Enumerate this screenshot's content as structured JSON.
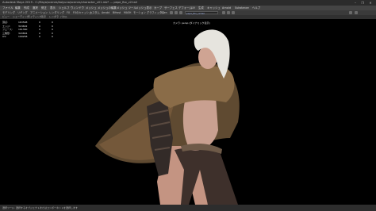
{
  "window": {
    "title": "Autodesk Maya 2019 - C:/Maya/scenes/kaiyuna/scenes/character_v01.mb* --- pepe_fbx_v2:tail",
    "controls": [
      "–",
      "❐",
      "✕"
    ]
  },
  "menubar": {
    "items": [
      "ファイル",
      "編集",
      "作成",
      "選択",
      "修正",
      "表示",
      "シェルフ",
      "ウィンドウ",
      "メッシュ",
      "メッシュの編集",
      "メッシュ ツール",
      "メッシュ表示",
      "カーブ",
      "サーフェス",
      "デフォーム",
      "UV",
      "生成",
      "キャッシュ",
      "Arnold",
      "Substance",
      "ヘルプ"
    ]
  },
  "shelf": {
    "items": [
      "モデリング",
      "リギング",
      "アニメーション",
      "レンダリング",
      "FX",
      "FXのキャッシュ",
      "カスタム",
      "Arnold",
      "Bifrost",
      "MASH",
      "モーション グラフィックス",
      "XGen"
    ],
    "field_value": "pepe_fbx_v2:tail"
  },
  "panel_menu": {
    "items": [
      "ビュー",
      "シェーディング",
      "ライティング",
      "表示",
      "レンダラ",
      "パネル"
    ]
  },
  "viewport": {
    "camera_label": "カメラ: persp (ダイナミック表示)",
    "stats": [
      {
        "label": "頂点:",
        "a": "163508",
        "b": "0",
        "c": "0"
      },
      {
        "label": "エッジ:",
        "a": "324602",
        "b": "0",
        "c": "0"
      },
      {
        "label": "フェース:",
        "a": "161390",
        "b": "0",
        "c": "0"
      },
      {
        "label": "三角形:",
        "a": "320804",
        "b": "0",
        "c": "0"
      },
      {
        "label": "UV:",
        "a": "199258",
        "b": "0",
        "c": "0"
      }
    ]
  },
  "helpline": {
    "text": "選択ツール: 選択するオブジェクトまたはコンポーネントを選択します"
  },
  "colors": {
    "titlebar": "#2b2b2b",
    "menubar": "#444444",
    "viewport_bg": "#000000",
    "skin": "#c79a8a",
    "fur": "#6b5236",
    "armor": "#3a3230",
    "hair": "#e4e2dc"
  }
}
